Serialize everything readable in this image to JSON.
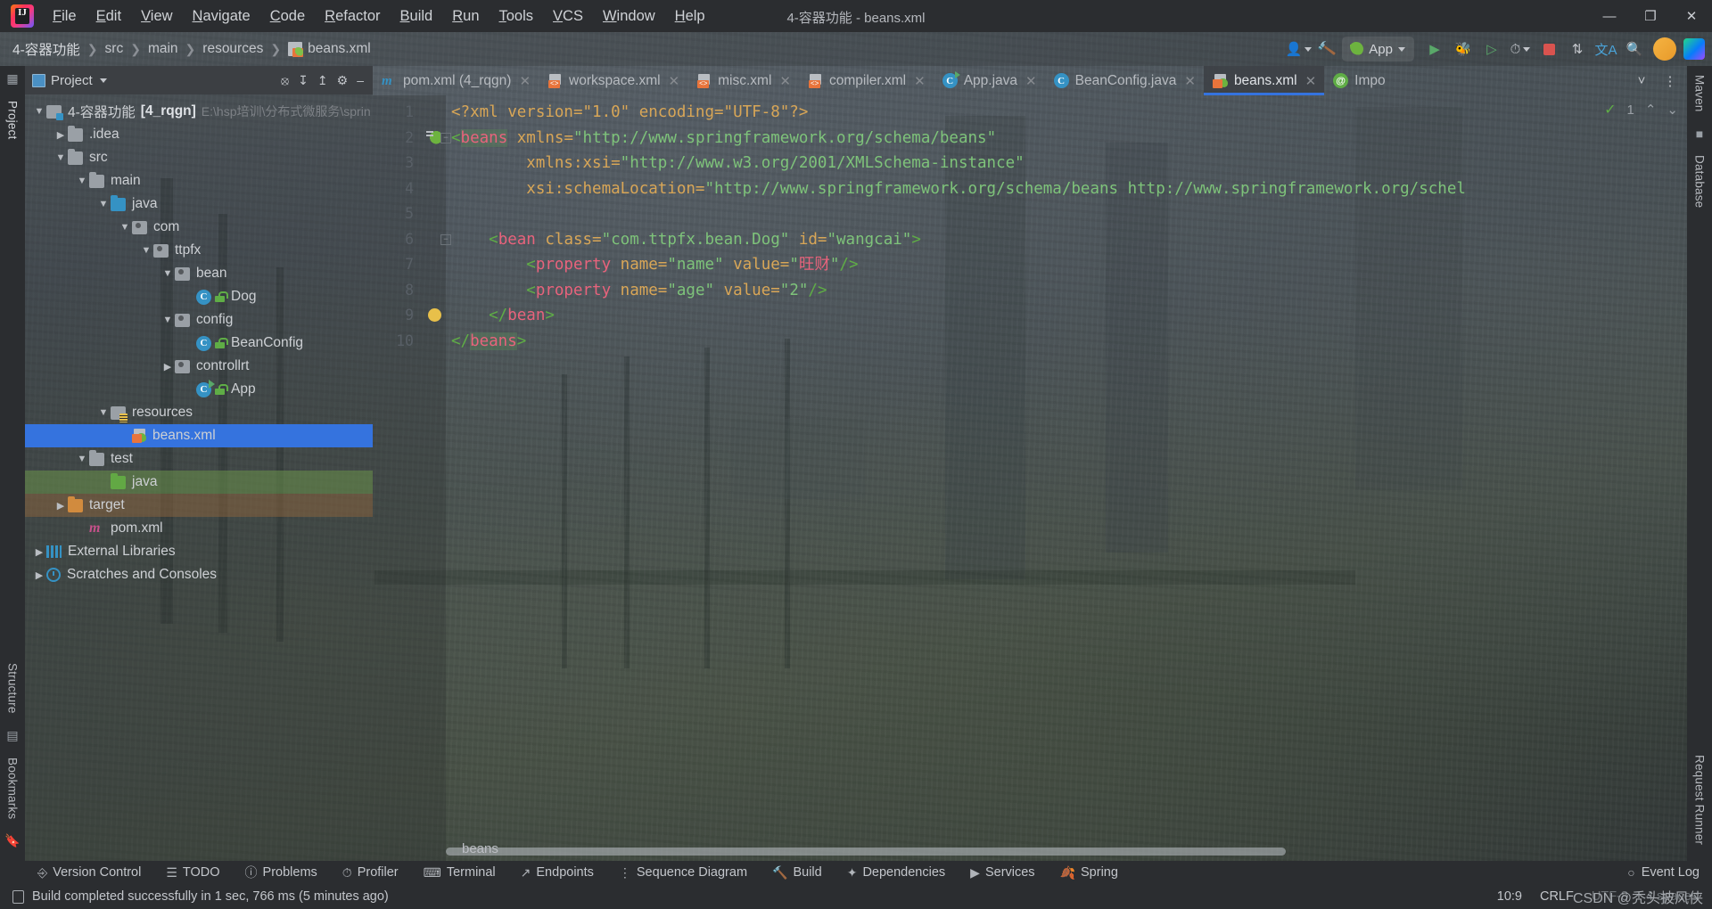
{
  "window": {
    "title": "4-容器功能 - beans.xml",
    "controls": {
      "minimize": "—",
      "maximize": "❐",
      "close": "✕"
    }
  },
  "menubar": {
    "items": [
      {
        "label": "File",
        "mnemonic": "F"
      },
      {
        "label": "Edit",
        "mnemonic": "E"
      },
      {
        "label": "View",
        "mnemonic": "V"
      },
      {
        "label": "Navigate",
        "mnemonic": "N"
      },
      {
        "label": "Code",
        "mnemonic": "C"
      },
      {
        "label": "Refactor",
        "mnemonic": "R"
      },
      {
        "label": "Build",
        "mnemonic": "B"
      },
      {
        "label": "Run",
        "mnemonic": "R"
      },
      {
        "label": "Tools",
        "mnemonic": "T"
      },
      {
        "label": "VCS",
        "mnemonic": "V"
      },
      {
        "label": "Window",
        "mnemonic": "W"
      },
      {
        "label": "Help",
        "mnemonic": "H"
      }
    ]
  },
  "navbar": {
    "breadcrumbs": [
      "4-容器功能",
      "src",
      "main",
      "resources",
      "beans.xml"
    ],
    "run_config": "App",
    "icons": [
      "settings-sync-icon",
      "build-hammer-icon",
      "run-icon",
      "debug-icon",
      "run-coverage-icon",
      "profiler-icon",
      "stop-icon",
      "updates-icon",
      "translate-icon",
      "search-everywhere-icon",
      "account-avatar",
      "ide-services-icon"
    ]
  },
  "left_rail": {
    "top": [
      "Project"
    ],
    "bottom": [
      "Structure",
      "Bookmarks"
    ]
  },
  "right_rail": {
    "items": [
      "Maven",
      "Database",
      "Request Runner"
    ]
  },
  "project_pane": {
    "title": "Project",
    "header_actions": [
      "select-opened-file-icon",
      "expand-all-icon",
      "collapse-all-icon",
      "settings-icon",
      "hide-icon"
    ],
    "tree": [
      {
        "depth": 0,
        "twist": "v",
        "icon": "module-folder",
        "label": "4-容器功能",
        "bold": "[4_rqgn]",
        "muted": "E:\\hsp培训\\分布式微服务\\sprin"
      },
      {
        "depth": 1,
        "twist": ">",
        "icon": "grey-folder",
        "label": ".idea"
      },
      {
        "depth": 1,
        "twist": "v",
        "icon": "grey-folder",
        "label": "src"
      },
      {
        "depth": 2,
        "twist": "v",
        "icon": "grey-folder",
        "label": "main"
      },
      {
        "depth": 3,
        "twist": "v",
        "icon": "src-folder",
        "label": "java"
      },
      {
        "depth": 4,
        "twist": "v",
        "icon": "package",
        "label": "com"
      },
      {
        "depth": 5,
        "twist": "v",
        "icon": "package",
        "label": "ttpfx"
      },
      {
        "depth": 6,
        "twist": "v",
        "icon": "package",
        "label": "bean"
      },
      {
        "depth": 7,
        "twist": "",
        "icon": "class",
        "label": "Dog"
      },
      {
        "depth": 6,
        "twist": "v",
        "icon": "package",
        "label": "config"
      },
      {
        "depth": 7,
        "twist": "",
        "icon": "class",
        "label": "BeanConfig"
      },
      {
        "depth": 6,
        "twist": ">",
        "icon": "package",
        "label": "controllrt"
      },
      {
        "depth": 7,
        "twist": "",
        "icon": "runnable-class",
        "label": "App"
      },
      {
        "depth": 3,
        "twist": "v",
        "icon": "resources-folder",
        "label": "resources"
      },
      {
        "depth": 4,
        "twist": "",
        "icon": "spring-xml",
        "label": "beans.xml",
        "selected": true
      },
      {
        "depth": 2,
        "twist": "v",
        "icon": "grey-folder",
        "label": "test"
      },
      {
        "depth": 3,
        "twist": "",
        "icon": "test-folder",
        "label": "java",
        "band": "green"
      },
      {
        "depth": 1,
        "twist": ">",
        "icon": "target-folder",
        "label": "target",
        "band": "orange"
      },
      {
        "depth": 2,
        "twist": "",
        "icon": "maven-file",
        "label": "pom.xml"
      },
      {
        "depth": 0,
        "twist": ">",
        "icon": "libraries",
        "label": "External Libraries"
      },
      {
        "depth": 0,
        "twist": ">",
        "icon": "scratches",
        "label": "Scratches and Consoles"
      }
    ]
  },
  "editor_tabs": {
    "tabs": [
      {
        "label": "pom.xml (4_rqgn)",
        "icon": "maven-file",
        "active": false,
        "closable": true
      },
      {
        "label": "workspace.xml",
        "icon": "xml-file",
        "active": false,
        "closable": true
      },
      {
        "label": "misc.xml",
        "icon": "xml-file",
        "active": false,
        "closable": true
      },
      {
        "label": "compiler.xml",
        "icon": "xml-file",
        "active": false,
        "closable": true
      },
      {
        "label": "App.java",
        "icon": "runnable-class",
        "active": false,
        "closable": true
      },
      {
        "label": "BeanConfig.java",
        "icon": "class",
        "active": false,
        "closable": true
      },
      {
        "label": "beans.xml",
        "icon": "spring-xml",
        "active": true,
        "closable": true
      },
      {
        "label": "Impo",
        "icon": "annotation-class",
        "active": false,
        "closable": false
      }
    ],
    "actions": [
      "chevron-down-icon",
      "more-options-icon"
    ]
  },
  "editor": {
    "inspection_count": "1",
    "lines": [
      {
        "n": "1",
        "mark": "",
        "tokens": [
          {
            "t": "<?xml version=\"1.0\" encoding=\"UTF-8\"?>",
            "c": "c-proc"
          }
        ]
      },
      {
        "n": "2",
        "mark": "spring-bean-gutter-icon",
        "fold": true,
        "tokens": [
          {
            "t": "<",
            "c": "c-brk"
          },
          {
            "t": "beans",
            "c": "c-tag hl-tag"
          },
          {
            "t": " xmlns=",
            "c": "c-attr"
          },
          {
            "t": "\"http://www.springframework.org/schema/beans\"",
            "c": "c-val"
          }
        ]
      },
      {
        "n": "3",
        "mark": "",
        "tokens": [
          {
            "t": "        xmlns:xsi=",
            "c": "c-attr"
          },
          {
            "t": "\"http://www.w3.org/2001/XMLSchema-instance\"",
            "c": "c-val"
          }
        ]
      },
      {
        "n": "4",
        "mark": "",
        "tokens": [
          {
            "t": "        xsi:schemaLocation=",
            "c": "c-attr"
          },
          {
            "t": "\"http://www.springframework.org/schema/beans http://www.springframework.org/schel",
            "c": "c-val"
          }
        ]
      },
      {
        "n": "5",
        "mark": "",
        "tokens": []
      },
      {
        "n": "6",
        "mark": "",
        "fold": true,
        "tokens": [
          {
            "t": "    <",
            "c": "c-brk"
          },
          {
            "t": "bean",
            "c": "c-tag"
          },
          {
            "t": " class=",
            "c": "c-attr"
          },
          {
            "t": "\"com.ttpfx.bean.Dog\"",
            "c": "c-val"
          },
          {
            "t": " id=",
            "c": "c-attr"
          },
          {
            "t": "\"wangcai\"",
            "c": "c-val"
          },
          {
            "t": ">",
            "c": "c-brk"
          }
        ]
      },
      {
        "n": "7",
        "mark": "",
        "tokens": [
          {
            "t": "        <",
            "c": "c-brk"
          },
          {
            "t": "property",
            "c": "c-tag"
          },
          {
            "t": " name=",
            "c": "c-attr"
          },
          {
            "t": "\"name\"",
            "c": "c-val"
          },
          {
            "t": " value=",
            "c": "c-attr"
          },
          {
            "t": "\"",
            "c": "c-val"
          },
          {
            "t": "旺财",
            "c": "c-cn"
          },
          {
            "t": "\"",
            "c": "c-val"
          },
          {
            "t": "/>",
            "c": "c-brk"
          }
        ]
      },
      {
        "n": "8",
        "mark": "",
        "tokens": [
          {
            "t": "        <",
            "c": "c-brk"
          },
          {
            "t": "property",
            "c": "c-tag"
          },
          {
            "t": " name=",
            "c": "c-attr"
          },
          {
            "t": "\"age\"",
            "c": "c-val"
          },
          {
            "t": " value=",
            "c": "c-attr"
          },
          {
            "t": "\"2\"",
            "c": "c-val"
          },
          {
            "t": "/>",
            "c": "c-brk"
          }
        ]
      },
      {
        "n": "9",
        "mark": "intention-bulb-icon",
        "tokens": [
          {
            "t": "    </",
            "c": "c-brk"
          },
          {
            "t": "bean",
            "c": "c-tag"
          },
          {
            "t": ">",
            "c": "c-brk"
          }
        ]
      },
      {
        "n": "10",
        "mark": "",
        "tokens": [
          {
            "t": "</",
            "c": "c-brk"
          },
          {
            "t": "beans",
            "c": "c-tag hl-tag"
          },
          {
            "t": ">",
            "c": "c-brk"
          }
        ]
      }
    ],
    "bottom_breadcrumb": "beans"
  },
  "bottom_toolwindows": [
    {
      "label": "Version Control",
      "icon": "branch-icon"
    },
    {
      "label": "TODO",
      "icon": "list-icon"
    },
    {
      "label": "Problems",
      "icon": "error-icon"
    },
    {
      "label": "Profiler",
      "icon": "profiler-icon"
    },
    {
      "label": "Terminal",
      "icon": "terminal-icon"
    },
    {
      "label": "Endpoints",
      "icon": "endpoints-icon"
    },
    {
      "label": "Sequence Diagram",
      "icon": "sequence-icon"
    },
    {
      "label": "Build",
      "icon": "hammer-icon"
    },
    {
      "label": "Dependencies",
      "icon": "dependencies-icon"
    },
    {
      "label": "Services",
      "icon": "services-icon"
    },
    {
      "label": "Spring",
      "icon": "spring-leaf-icon"
    }
  ],
  "event_log": {
    "label": "Event Log",
    "icon": "event-log-icon"
  },
  "statusbar": {
    "message": "Build completed successfully in 1 sec, 766 ms (5 minutes ago)",
    "caret": "10:9",
    "line_separator": "CRLF",
    "encoding": "UTF-8",
    "indent": "4 spaces"
  },
  "watermark": {
    "text": "CSDN @秃头披风侠",
    "accent": "#d14b3e"
  }
}
